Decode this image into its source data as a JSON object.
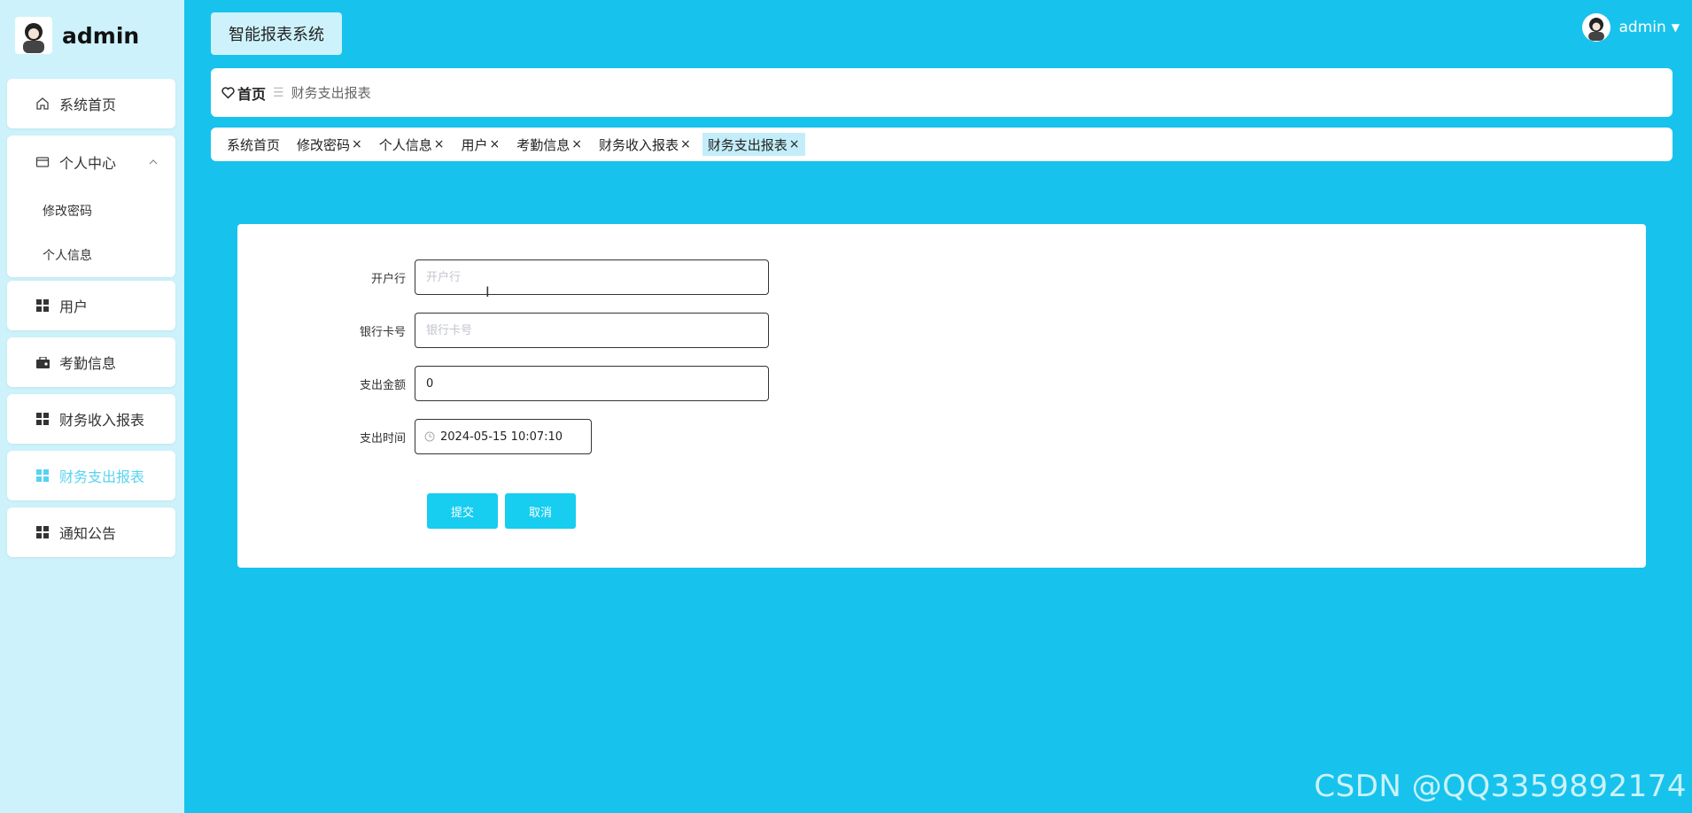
{
  "sidebar": {
    "username": "admin",
    "items": [
      {
        "label": "系统首页",
        "icon": "home-icon"
      },
      {
        "label": "个人中心",
        "icon": "wallet-icon",
        "expanded": true,
        "children": [
          {
            "label": "修改密码"
          },
          {
            "label": "个人信息"
          }
        ]
      },
      {
        "label": "用户",
        "icon": "grid-icon"
      },
      {
        "label": "考勤信息",
        "icon": "briefcase-icon"
      },
      {
        "label": "财务收入报表",
        "icon": "grid-icon"
      },
      {
        "label": "财务支出报表",
        "icon": "grid-icon",
        "active": true
      },
      {
        "label": "通知公告",
        "icon": "grid-icon"
      }
    ]
  },
  "header": {
    "system_title": "智能报表系统",
    "user": "admin"
  },
  "breadcrumb": {
    "home": "首页",
    "current": "财务支出报表"
  },
  "tags": [
    {
      "label": "系统首页",
      "closable": false
    },
    {
      "label": "修改密码",
      "closable": true
    },
    {
      "label": "个人信息",
      "closable": true
    },
    {
      "label": "用户",
      "closable": true
    },
    {
      "label": "考勤信息",
      "closable": true
    },
    {
      "label": "财务收入报表",
      "closable": true
    },
    {
      "label": "财务支出报表",
      "closable": true,
      "active": true
    }
  ],
  "form": {
    "bank": {
      "label": "开户行",
      "placeholder": "开户行",
      "value": ""
    },
    "card": {
      "label": "银行卡号",
      "placeholder": "银行卡号",
      "value": ""
    },
    "amount": {
      "label": "支出金额",
      "value": "0"
    },
    "time": {
      "label": "支出时间",
      "value": "2024-05-15 10:07:10"
    },
    "submit_label": "提交",
    "cancel_label": "取消"
  },
  "watermark": "CSDN @QQ3359892174",
  "colors": {
    "background": "#17c3ec",
    "sidebar": "#cdf2fb",
    "accent": "#17cdf0",
    "active_text": "#56d3f0"
  }
}
